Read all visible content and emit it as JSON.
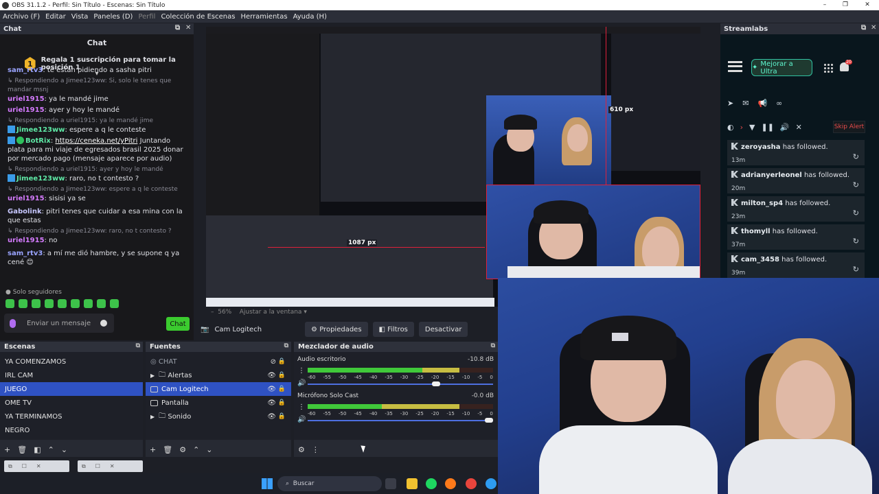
{
  "window": {
    "title": "OBS 31.1.2 - Perfil: Sin Título - Escenas: Sin Título",
    "minimize": "–",
    "maximize": "❐",
    "close": "✕"
  },
  "menu": [
    "Archivo (F)",
    "Editar",
    "Vista",
    "Paneles (D)",
    "Perfil",
    "Colección de Escenas",
    "Herramientas",
    "Ayuda (H)"
  ],
  "chat": {
    "dock_title": "Chat",
    "header": "Chat",
    "pinned": "Regala 1 suscripción para tomar la posición 1",
    "pinned_rank": "1",
    "messages": [
      {
        "user": "sam_rtv3",
        "text": ": te están pidiendo a sasha pitri"
      },
      {
        "reply": "Respondiendo a Jimee123ww: Si, solo le tenes que mandar msnj",
        "user": "uriel1915",
        "text": ": ya le mandé jime"
      },
      {
        "user": "uriel1915",
        "text": ": ayer y hoy le mandé"
      },
      {
        "reply": "Respondiendo a uriel1915: ya le mandé jime",
        "user": "Jimee123ww",
        "text": ": espere a q le conteste"
      },
      {
        "user": "BotRix",
        "link": "https://ceneka.net/yPitri",
        "text": " Juntando plata para mi viaje de egresados brasil 2025 donar por mercado pago (mensaje aparece por audio)"
      },
      {
        "reply": "Respondiendo a uriel1915: ayer y hoy le mandé",
        "user": "Jimee123ww",
        "text": ": raro, no t contesto ?"
      },
      {
        "reply": "Respondiendo a Jimee123ww: espere a q le conteste",
        "user": "uriel1915",
        "text": ": sisisi ya se"
      },
      {
        "user": "Gabolink",
        "text": ": pitri tenes que cuidar a esa mina con la que estas"
      },
      {
        "reply": "Respondiendo a Jimee123ww: raro, no t contesto ?",
        "user": "uriel1915",
        "text": ": no"
      },
      {
        "user": "sam_rtv3",
        "text": ": a mí me dió hambre, y se supone q ya cené 😊"
      }
    ],
    "followers_only": "Solo seguidores",
    "input_placeholder": "Enviar un mensaje",
    "send_label": "Chat"
  },
  "preview": {
    "zoom": "56%",
    "fit": "Ajustar a la ventana",
    "measure_1": "610 px",
    "measure_2": "1087 px"
  },
  "source_bar": {
    "source": "Cam Logitech",
    "properties": "Propiedades",
    "filters": "Filtros",
    "deactivate": "Desactivar"
  },
  "streamlabs": {
    "title": "Streamlabs",
    "upgrade": "Mejorar a Ultra",
    "notif_count": "20",
    "skip_alert": "Skip Alert",
    "events": [
      {
        "user": "zeroyasha",
        "action": "has followed.",
        "time": "13m"
      },
      {
        "user": "adrianyerleonel",
        "action": "has followed.",
        "time": "20m"
      },
      {
        "user": "milton_sp4",
        "action": "has followed.",
        "time": "23m"
      },
      {
        "user": "thomyll",
        "action": "has followed.",
        "time": "37m"
      },
      {
        "user": "cam_3458",
        "action": "has followed.",
        "time": "39m"
      }
    ]
  },
  "scenes": {
    "title": "Escenas",
    "items": [
      "YA COMENZAMOS",
      "IRL CAM",
      "JUEGO",
      "OME TV",
      "YA TERMINAMOS",
      "NEGRO"
    ],
    "selected": "JUEGO"
  },
  "sources": {
    "title": "Fuentes",
    "items": [
      "CHAT",
      "Alertas",
      "Cam Logitech",
      "Pantalla",
      "Sonido"
    ]
  },
  "mixer": {
    "title": "Mezclador de audio",
    "tracks": [
      {
        "name": "Audio escritorio",
        "db": "-10.8 dB",
        "level": 0.62,
        "volume": 0.7
      },
      {
        "name": "Micrófono Solo Cast",
        "db": "-0.0 dB",
        "level": 0.4,
        "volume": 1.0
      }
    ],
    "scale": [
      "-60",
      "-55",
      "-50",
      "-45",
      "-40",
      "-35",
      "-30",
      "-25",
      "-20",
      "-15",
      "-10",
      "-5",
      "0"
    ]
  },
  "taskbar": {
    "search": "Buscar"
  },
  "colors": {
    "accent": "#2f52c3",
    "kick_green": "#3bcb2f",
    "selection_red": "#e0203a",
    "streamlabs_teal": "#31c3a2"
  }
}
